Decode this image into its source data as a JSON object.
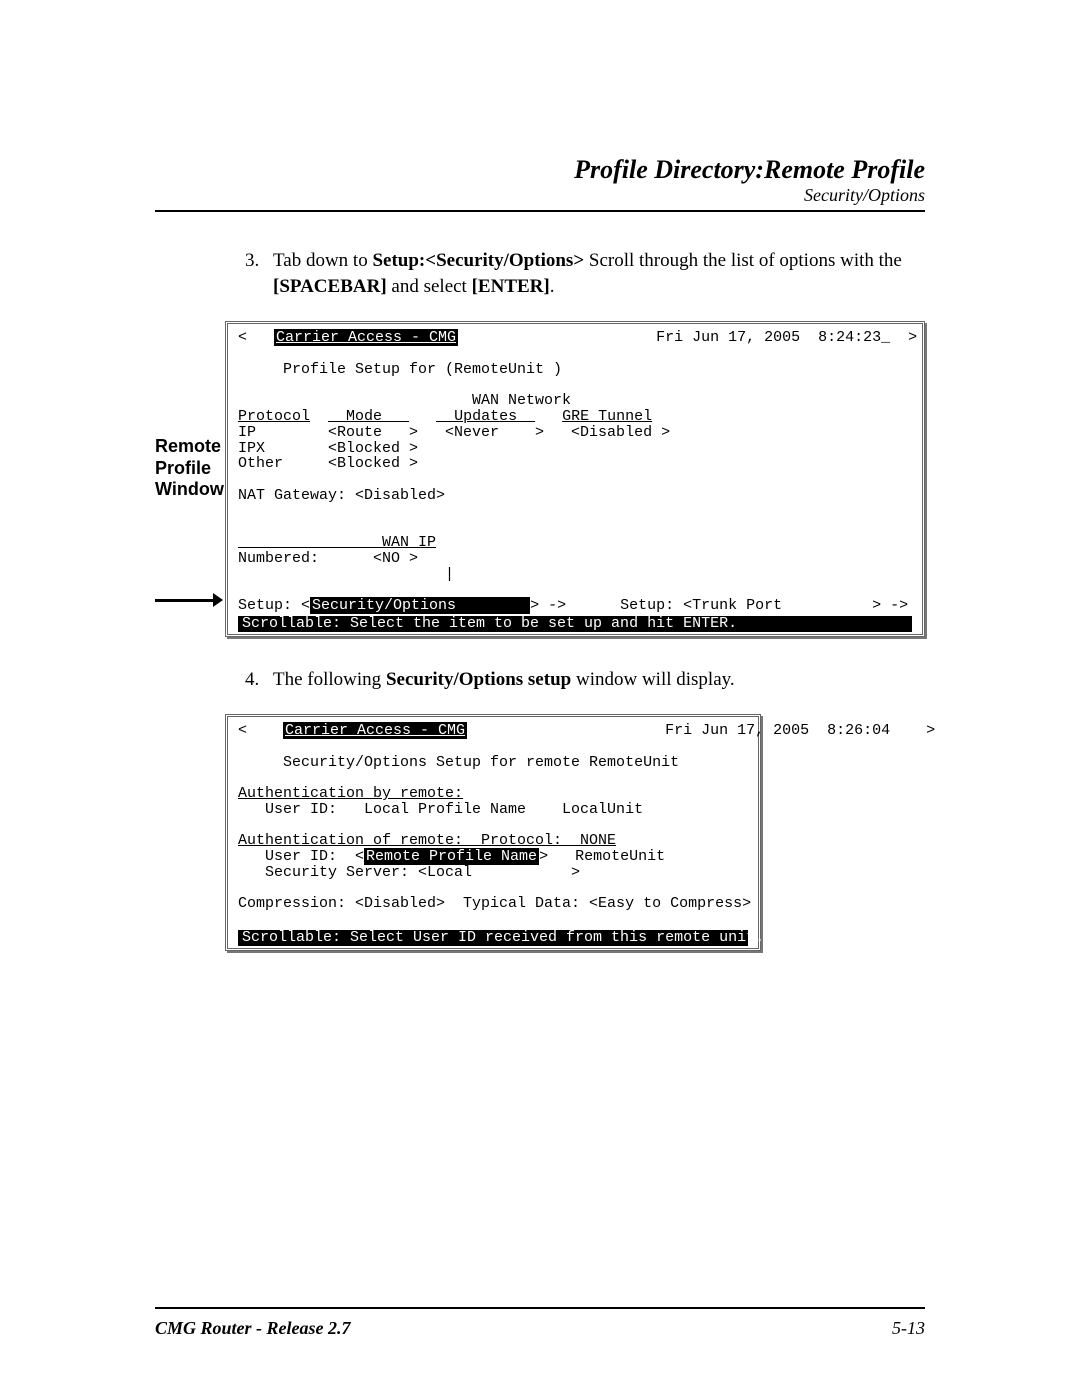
{
  "header": {
    "title": "Profile Directory:Remote Profile",
    "subtitle": "Security/Options"
  },
  "step3": {
    "num": "3.",
    "t1": "Tab down to ",
    "b1": "Setup:<Security/Options>",
    "t2": " Scroll through the list of options with the ",
    "b2": "[SPACEBAR]",
    "t3": " and select ",
    "b3": "[ENTER]",
    "t4": "."
  },
  "step4": {
    "num": "4.",
    "t1": "The following ",
    "b1": "Security/Options setup",
    "t2": " window will display."
  },
  "side_label": "Remote Profile Window",
  "screen1": {
    "toprow_left": "<   ",
    "toprow_title": "Carrier Access - CMG",
    "toprow_right": "                      Fri Jun 17, 2005  8:24:23_  >",
    "line2": "     Profile Setup for (RemoteUnit )",
    "hdr_wan": "                          WAN Network",
    "hdr_cols": {
      "proto": "Protocol",
      "mode": "  Mode   ",
      "upd": "  Updates  ",
      "gre": "GRE Tunnel"
    },
    "hdr_cols_raw_pre": "",
    "row_ip": "IP        <Route   >   <Never    >   <Disabled >",
    "row_ipx": "IPX       <Blocked >",
    "row_other": "Other     <Blocked >",
    "nat": "NAT Gateway: <Disabled>",
    "wanip_hdr": "                WAN IP",
    "wanip_row": "Numbered:      <NO >",
    "cursor": "                       |",
    "setup_pre": "Setup: <",
    "setup_sel": "Security/Options        ",
    "setup_post": "> ->      Setup: <Trunk Port          > ->",
    "bottom": "Scrollable: Select the item to be set up and hit ENTER.                         "
  },
  "screen2": {
    "toprow_left": "<    ",
    "toprow_title": "Carrier Access - CMG",
    "toprow_right": "                      Fri Jun 17, 2005  8:26:04    >",
    "line2": "     Security/Options Setup for remote RemoteUnit",
    "auth_by_hdr": "Authentication by remote:",
    "auth_by_row": "   User ID:   Local Profile Name    LocalUnit",
    "auth_of_hdr": "Authentication of remote:  Protocol:  NONE",
    "auth_of_row_pre": "   User ID:  <",
    "auth_of_sel": "Remote Profile Name",
    "auth_of_row_post": ">   RemoteUnit",
    "sec_srv": "   Security Server: <Local           >",
    "comp": "Compression: <Disabled>  Typical Data: <Easy to Compress>",
    "bottom": "Scrollable: Select User ID received from this remote unit.                 "
  },
  "footer": {
    "left": "CMG Router - Release 2.7",
    "right": "5-13"
  }
}
